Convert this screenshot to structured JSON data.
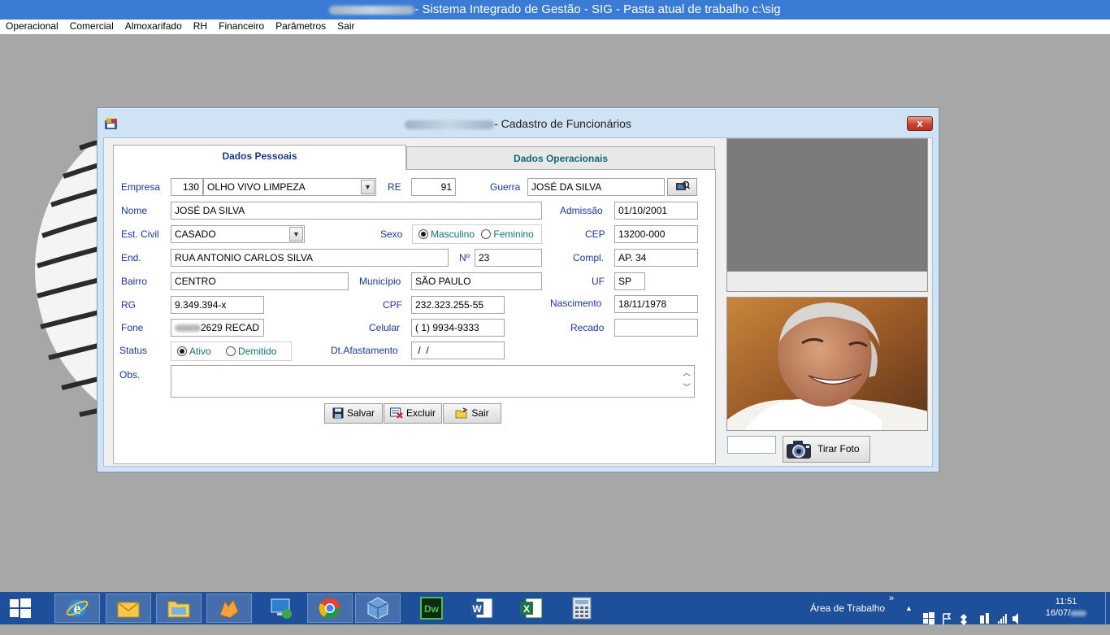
{
  "app": {
    "title": "- Sistema Integrado de Gestão - SIG - Pasta atual de trabalho c:\\sig",
    "menu": [
      "Operacional",
      "Comercial",
      "Almoxarifado",
      "RH",
      "Financeiro",
      "Parâmetros",
      "Sair"
    ]
  },
  "dialog": {
    "title": "- Cadastro de Funcionários",
    "close_label": "x",
    "tabs": [
      "Dados Pessoais",
      "Dados Operacionais"
    ],
    "labels": {
      "empresa": "Empresa",
      "re": "RE",
      "guerra": "Guerra",
      "nome": "Nome",
      "admissao": "Admissão",
      "est_civil": "Est. Civil",
      "sexo": "Sexo",
      "cep": "CEP",
      "end": "End.",
      "numero": "Nº",
      "compl": "Compl.",
      "bairro": "Bairro",
      "municipio": "Município",
      "uf": "UF",
      "rg": "RG",
      "cpf": "CPF",
      "nascimento": "Nascimento",
      "fone": "Fone",
      "celular": "Celular",
      "recado": "Recado",
      "status": "Status",
      "dt_afastamento": "Dt.Afastamento",
      "obs": "Obs."
    },
    "values": {
      "empresa_code": "130",
      "empresa_name": "OLHO VIVO LIMPEZA",
      "re": "91",
      "guerra": "JOSÉ DA SILVA",
      "nome": "JOSÉ DA SILVA",
      "admissao": "01/10/2001",
      "est_civil": "CASADO",
      "cep": "13200-000",
      "end": "RUA ANTONIO CARLOS SILVA",
      "numero": "23",
      "compl": "AP. 34",
      "bairro": "CENTRO",
      "municipio": "SÃO PAULO",
      "uf": "SP",
      "rg": "9.349.394-x",
      "cpf": "232.323.255-55",
      "nascimento": "18/11/1978",
      "fone": "2629 RECAD",
      "celular": "( 1) 9934-9333",
      "recado": "",
      "dt_afastamento": " /  /",
      "obs": ""
    },
    "sexo_options": [
      "Masculino",
      "Feminino"
    ],
    "sexo_selected": "Masculino",
    "status_options": [
      "Ativo",
      "Demitido"
    ],
    "status_selected": "Ativo",
    "buttons": {
      "salvar": "Salvar",
      "excluir": "Excluir",
      "sair": "Sair"
    },
    "photo_button": "Tirar Foto"
  },
  "taskbar": {
    "desktop_label": "Área de Trabalho",
    "time": "11:51",
    "date": "16/07/"
  }
}
